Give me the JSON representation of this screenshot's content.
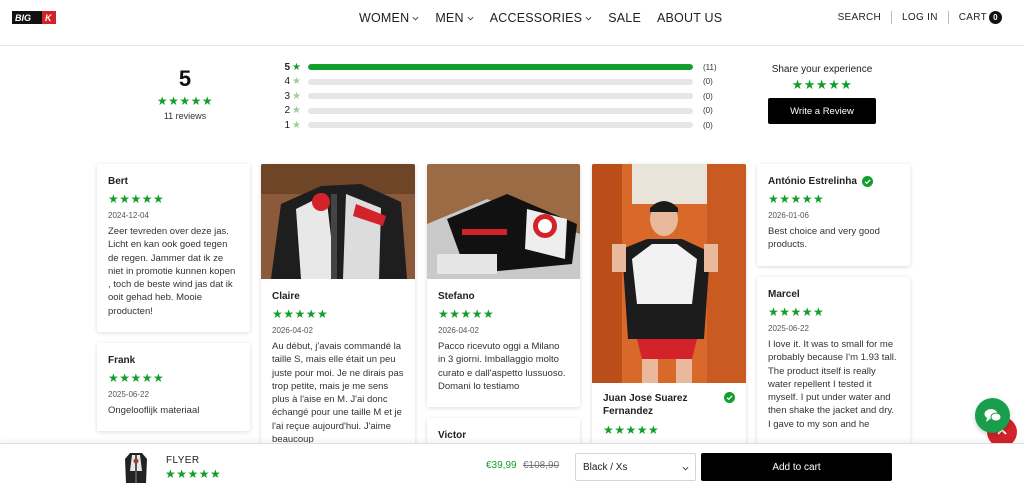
{
  "header": {
    "logo_text": "BIG K",
    "nav": [
      {
        "label": "WOMEN",
        "dropdown": true
      },
      {
        "label": "MEN",
        "dropdown": true
      },
      {
        "label": "ACCESSORIES",
        "dropdown": true
      },
      {
        "label": "SALE",
        "dropdown": false
      },
      {
        "label": "ABOUT US",
        "dropdown": false
      }
    ],
    "search_label": "SEARCH",
    "login_label": "LOG IN",
    "cart_label": "CART",
    "cart_count": "0"
  },
  "summary": {
    "average": "5",
    "stars": "★★★★★",
    "review_count": "11 reviews",
    "distribution": [
      {
        "stars": "5",
        "count": "(11)",
        "fraction": 1.0
      },
      {
        "stars": "4",
        "count": "(0)",
        "fraction": 0
      },
      {
        "stars": "3",
        "count": "(0)",
        "fraction": 0
      },
      {
        "stars": "2",
        "count": "(0)",
        "fraction": 0
      },
      {
        "stars": "1",
        "count": "(0)",
        "fraction": 0
      }
    ],
    "share_label": "Share your experience",
    "write_review_label": "Write a Review"
  },
  "reviews": [
    {
      "name": "Bert",
      "stars": "★★★★★",
      "date": "2024-12-04",
      "text": "Zeer tevreden over deze jas. Licht en kan ook goed tegen de regen. Jammer dat ik ze niet in promotie kunnen kopen , toch de beste wind jas dat ik ooit gehad heb. Mooie producten!"
    },
    {
      "name": "Frank",
      "stars": "★★★★★",
      "date": "2025-06-22",
      "text": "Ongelooflijk materiaal"
    },
    {
      "name": "Claire",
      "stars": "★★★★★",
      "date": "2026-04-02",
      "text": "Au début, j'avais commandé la taille S, mais elle était un peu juste pour moi. Je ne dirais pas trop petite, mais je me sens plus à l'aise en M. J'ai donc échangé pour une taille M et je l'ai reçue aujourd'hui. J'aime beaucoup"
    },
    {
      "name": "Stefano",
      "stars": "★★★★★",
      "date": "2026-04-02",
      "text": "Pacco ricevuto oggi a Milano in 3 giorni. Imballaggio molto curato e dall'aspetto lussuoso. Domani lo testiamo"
    },
    {
      "name": "Victor",
      "stars": "",
      "date": "",
      "text": ""
    },
    {
      "name": "Juan Jose Suarez Fernandez",
      "stars": "★★★★★",
      "date": "",
      "text": "",
      "verified": true
    },
    {
      "name": "António Estrelinha",
      "stars": "★★★★★",
      "date": "2026-01-06",
      "text": "Best choice and very good products.",
      "verified": true
    },
    {
      "name": "Marcel",
      "stars": "★★★★★",
      "date": "2025-06-22",
      "text": "I love it. It was to small for me probably because I'm 1.93 tall.\nThe product itself is really water repellent I tested it myself. I put under water and then shake the jacket and dry. I gave to my son and he"
    }
  ],
  "sticky": {
    "product_name": "FLYER",
    "stars": "★★★★★",
    "price": "€39,99",
    "old_price": "€108,90",
    "variant": "Black / Xs",
    "add_to_cart_label": "Add to cart"
  },
  "colors": {
    "accent": "#119e2a",
    "brand_red": "#d3222a",
    "button": "#000000"
  }
}
